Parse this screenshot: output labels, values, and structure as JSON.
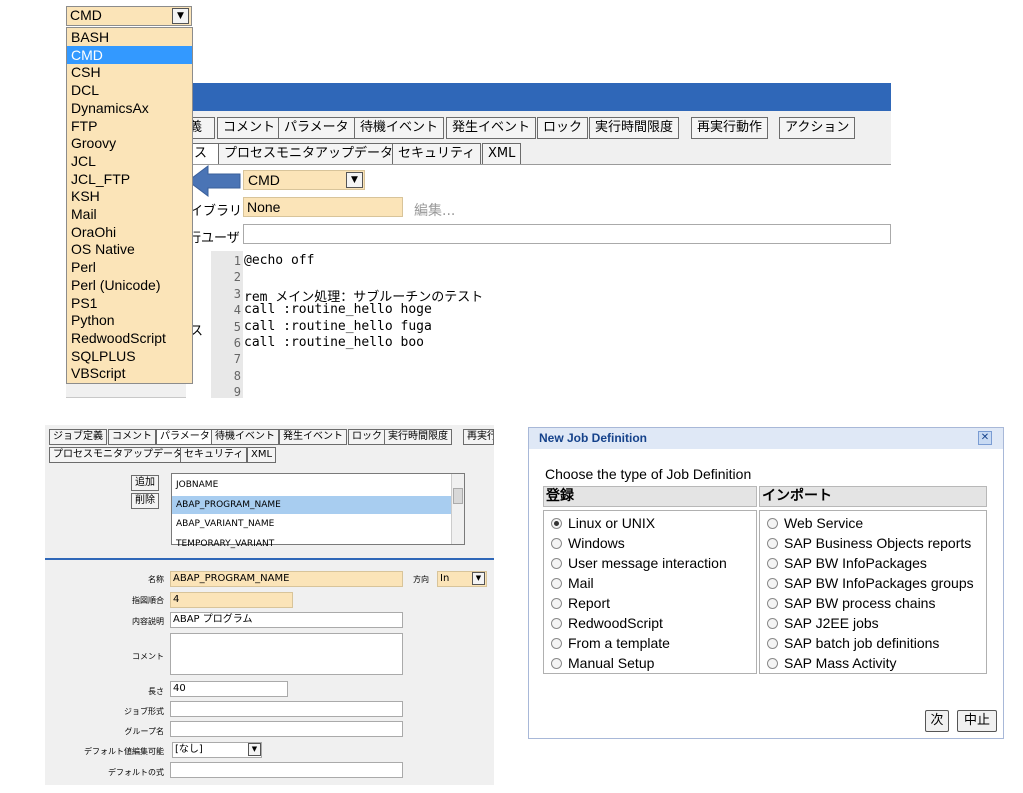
{
  "dropdown": {
    "selected": "CMD",
    "items": [
      "BASH",
      "CMD",
      "CSH",
      "DCL",
      "DynamicsAx",
      "FTP",
      "Groovy",
      "JCL",
      "JCL_FTP",
      "KSH",
      "Mail",
      "OraOhi",
      "OS Native",
      "Perl",
      "Perl (Unicode)",
      "PS1",
      "Python",
      "RedwoodScript",
      "SQLPLUS",
      "VBScript"
    ]
  },
  "top_panel": {
    "tabs_row1": [
      "義",
      "コメント",
      "パラメータ",
      "待機イベント",
      "発生イベント",
      "ロック",
      "実行時間限度",
      "再実行動作",
      "アクション"
    ],
    "tabs_row2": [
      "ス",
      "プロセスモニタアップデータ",
      "セキュリティ",
      "XML"
    ],
    "type_value": "CMD",
    "library_label": "イブラリ",
    "library_value": "None",
    "edit_link": "編集...",
    "user_label": "行ユーザ",
    "source_label": "ス",
    "code_lines": [
      {
        "n": "1",
        "text": "@echo off"
      },
      {
        "n": "2",
        "text": ""
      },
      {
        "n": "3",
        "text": "rem メイン処理：サブルーチンのテスト"
      },
      {
        "n": "4",
        "text": "call :routine_hello hoge"
      },
      {
        "n": "5",
        "text": "call :routine_hello fuga"
      },
      {
        "n": "6",
        "text": "call :routine_hello boo"
      },
      {
        "n": "7",
        "text": ""
      },
      {
        "n": "8",
        "text": ""
      },
      {
        "n": "9",
        "text": ""
      }
    ]
  },
  "params_panel": {
    "tabs_row1": [
      "ジョブ定義",
      "コメント",
      "パラメータ",
      "待機イベント",
      "発生イベント",
      "ロック",
      "実行時間限度",
      "再実行"
    ],
    "tabs_row2": [
      "プロセスモニタアップデータ",
      "セキュリティ",
      "XML"
    ],
    "add_button": "追加",
    "delete_button": "削除",
    "list_items": [
      "JOBNAME",
      "ABAP_PROGRAM_NAME",
      "ABAP_VARIANT_NAME",
      "TEMPORARY_VARIANT"
    ],
    "selected_index": 1,
    "fields": {
      "name_label": "名称",
      "name_value": "ABAP_PROGRAM_NAME",
      "direction_label": "方向",
      "direction_value": "In",
      "order_label": "指図順合",
      "order_value": "4",
      "desc_label": "内容説明",
      "desc_value": "ABAP プログラム",
      "comment_label": "コメント",
      "comment_value": "",
      "length_label": "長さ",
      "length_value": "40",
      "job_format_label": "ジョブ形式",
      "job_format_value": "",
      "group_label": "グループ名",
      "group_value": "",
      "default_edit_label": "デフォルト値編集可能",
      "default_edit_value": "[なし]",
      "default_expr_label": "デフォルトの式",
      "default_expr_value": ""
    }
  },
  "dialog": {
    "title": "New Job Definition",
    "prompt": "Choose the type of Job Definition",
    "col1_header": "登録",
    "col2_header": "インポート",
    "col1_options": [
      "Linux or UNIX",
      "Windows",
      "User message interaction",
      "Mail",
      "Report",
      "RedwoodScript",
      "From a template",
      "Manual Setup"
    ],
    "col2_options": [
      "Web Service",
      "SAP Business Objects reports",
      "SAP BW InfoPackages",
      "SAP BW InfoPackages groups",
      "SAP BW process chains",
      "SAP J2EE jobs",
      "SAP batch job definitions",
      "SAP Mass Activity"
    ],
    "selected": "Linux or UNIX",
    "next_button": "次",
    "cancel_button": "中止"
  }
}
